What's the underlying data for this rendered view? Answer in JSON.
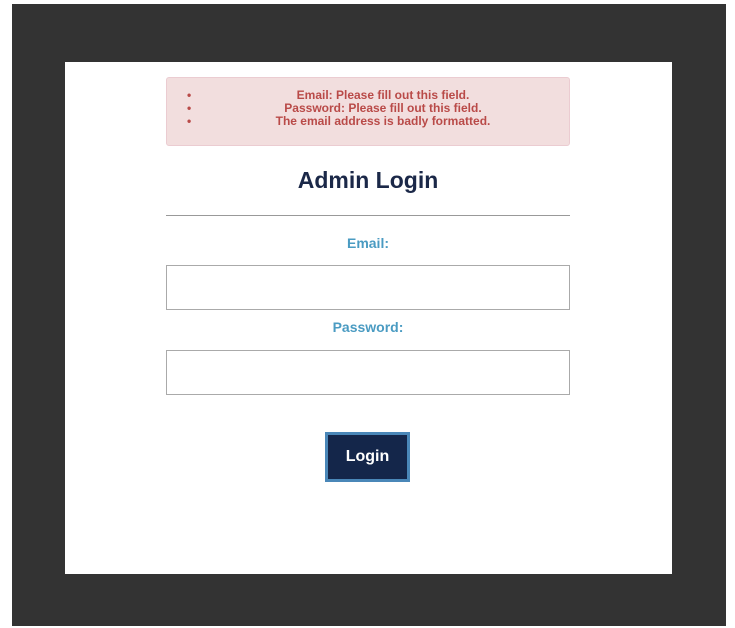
{
  "alert": {
    "errors": [
      "Email: Please fill out this field.",
      "Password: Please fill out this field.",
      "The email address is badly formatted."
    ],
    "bullet": "•"
  },
  "login_form": {
    "title": "Admin Login",
    "email_label": "Email:",
    "email_value": "",
    "password_label": "Password:",
    "password_value": "",
    "submit_label": "Login"
  },
  "colors": {
    "frame_background": "#333333",
    "card_background": "#ffffff",
    "error_background": "#f2dede",
    "error_text": "#b94a48",
    "title_text": "#1b2848",
    "label_text": "#4a9bc2",
    "button_background": "#14264a",
    "button_border": "#4a87b8"
  }
}
